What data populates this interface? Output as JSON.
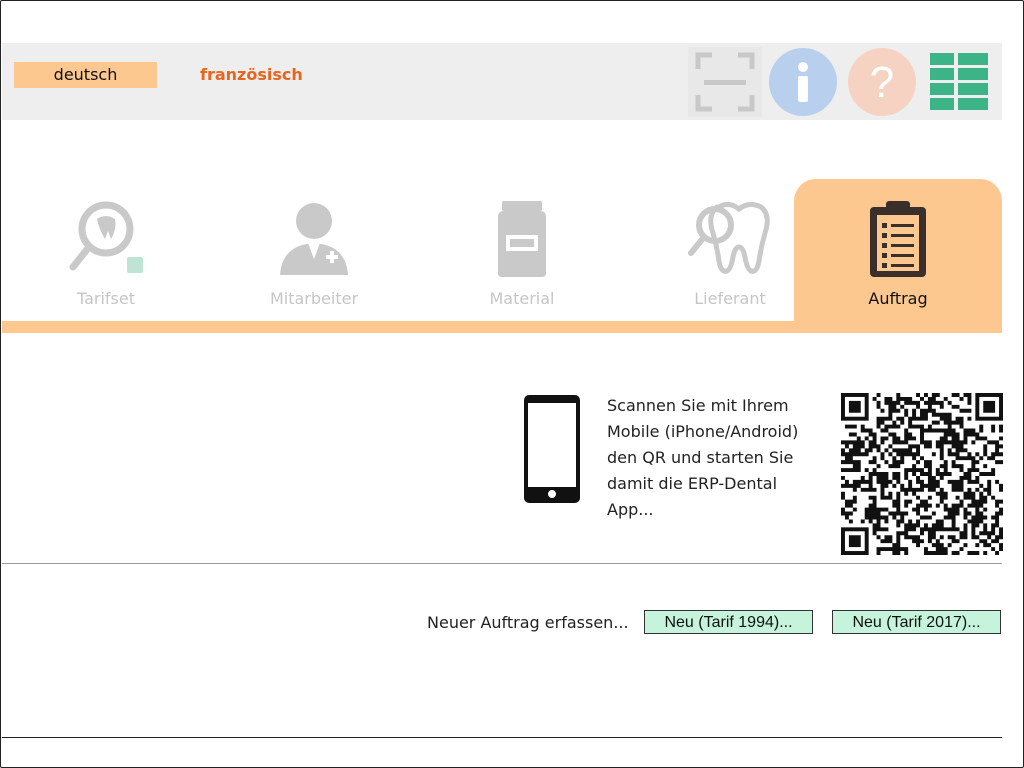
{
  "header": {
    "languages": {
      "active": "deutsch",
      "other": "französisch"
    },
    "toolbar": {
      "scan_icon": "scan-frame-icon",
      "info_icon": "info-icon",
      "help_icon": "question-icon",
      "grid_icon": "grid-icon",
      "colors": {
        "info": "#b8d0ee",
        "help": "#f5d2c2",
        "grid": "#3db487"
      }
    }
  },
  "tabs": [
    {
      "label": "Tarifset",
      "icon": "tooth-magnifier-icon",
      "active": false
    },
    {
      "label": "Mitarbeiter",
      "icon": "doctor-icon",
      "active": false
    },
    {
      "label": "Material",
      "icon": "jar-icon",
      "active": false
    },
    {
      "label": "Lieferant",
      "icon": "tooth-search-icon",
      "active": false
    },
    {
      "label": "Auftrag",
      "icon": "clipboard-icon",
      "active": true
    }
  ],
  "scan": {
    "text": "Scannen Sie mit Ihrem Mobile (iPhone/Android) den QR und starten Sie damit die ERP-Dental App..."
  },
  "new_order": {
    "label": "Neuer Auftrag erfassen...",
    "buttons": [
      {
        "label": "Neu (Tarif 1994)..."
      },
      {
        "label": "Neu (Tarif 2017)..."
      }
    ]
  },
  "colors": {
    "accent": "#fcc890",
    "accent_text": "#e8651c",
    "button_bg": "#c5f3dc"
  }
}
